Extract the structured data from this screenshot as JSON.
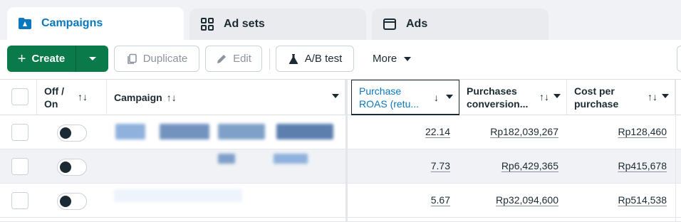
{
  "tabs": [
    {
      "label": "Campaigns",
      "icon": "folder-flag-icon",
      "active": true
    },
    {
      "label": "Ad sets",
      "icon": "grid-icon",
      "active": false
    },
    {
      "label": "Ads",
      "icon": "window-icon",
      "active": false
    }
  ],
  "toolbar": {
    "create_label": "Create",
    "duplicate_label": "Duplicate",
    "edit_label": "Edit",
    "ab_test_label": "A/B test",
    "more_label": "More"
  },
  "columns": {
    "off_on": "Off / On",
    "campaign": "Campaign",
    "roas": "Purchase ROAS (retu...",
    "purchases": "Purchases conversion...",
    "cost": "Cost per purchase"
  },
  "sort_glyph": "↑↓",
  "rows": [
    {
      "roas": "22.14",
      "purchases": "Rp182,039,267",
      "cost": "Rp128,460"
    },
    {
      "roas": "7.73",
      "purchases": "Rp6,429,365",
      "cost": "Rp415,678"
    },
    {
      "roas": "5.67",
      "purchases": "Rp32,094,600",
      "cost": "Rp514,538"
    }
  ],
  "colors": {
    "accent": "#0a78be",
    "create": "#0a7a4a",
    "text": "#1c2b33"
  }
}
